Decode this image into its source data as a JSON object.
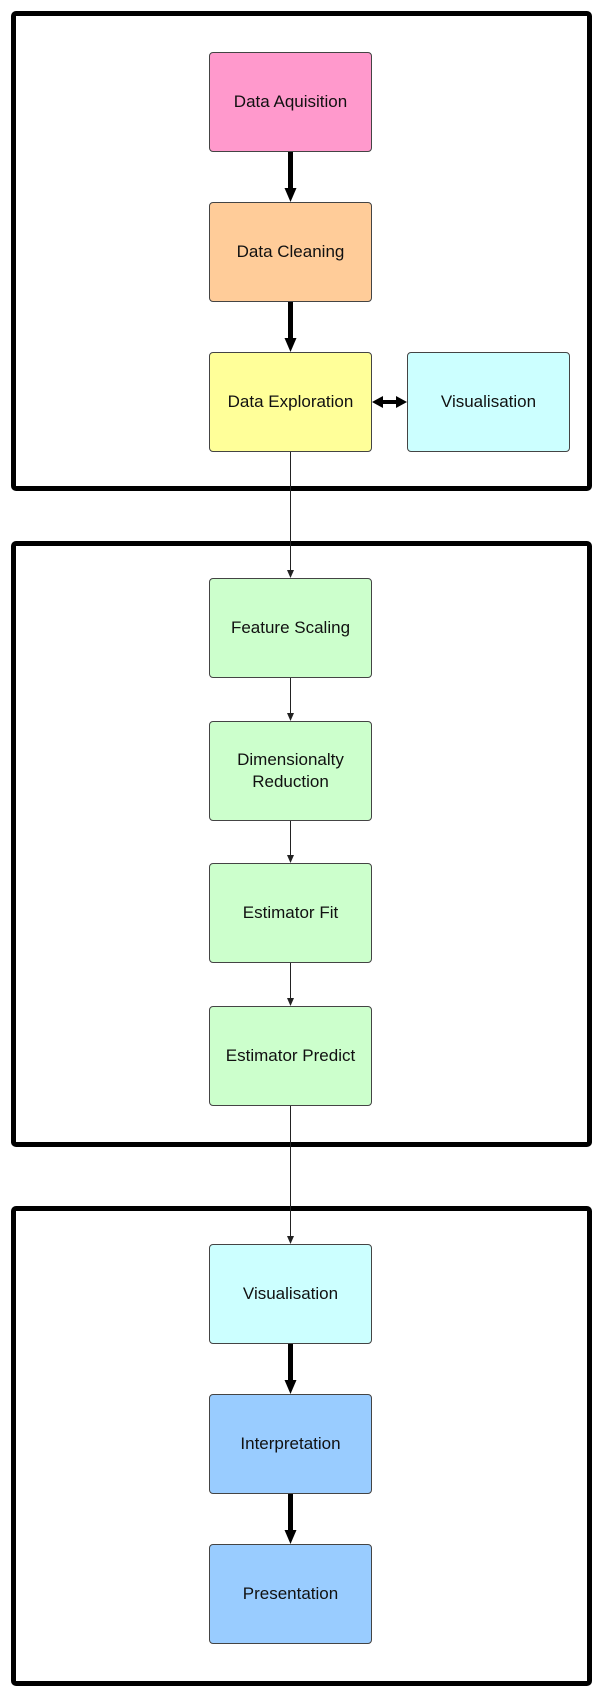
{
  "diagram": {
    "groups": [
      {
        "id": "data-preparation"
      },
      {
        "id": "modelling"
      },
      {
        "id": "communication"
      }
    ],
    "nodes": [
      {
        "id": "data-aquisition",
        "label": "Data Aquisition",
        "color": "#FF99CC"
      },
      {
        "id": "data-cleaning",
        "label": "Data Cleaning",
        "color": "#FFCC99"
      },
      {
        "id": "data-exploration",
        "label": "Data Exploration",
        "color": "#FFFF99"
      },
      {
        "id": "visualisation-explore",
        "label": "Visualisation",
        "color": "#CCFFFF"
      },
      {
        "id": "feature-scaling",
        "label": "Feature Scaling",
        "color": "#CCFFCC"
      },
      {
        "id": "dimensionality-reduction",
        "label": "Dimensionalty Reduction",
        "color": "#CCFFCC"
      },
      {
        "id": "estimator-fit",
        "label": "Estimator Fit",
        "color": "#CCFFCC"
      },
      {
        "id": "estimator-predict",
        "label": "Estimator Predict",
        "color": "#CCFFCC"
      },
      {
        "id": "visualisation-results",
        "label": "Visualisation",
        "color": "#CCFFFF"
      },
      {
        "id": "interpretation",
        "label": "Interpretation",
        "color": "#99CCFF"
      },
      {
        "id": "presentation",
        "label": "Presentation",
        "color": "#99CCFF"
      }
    ],
    "edges": [
      {
        "from": "data-aquisition",
        "to": "data-cleaning",
        "style": "thick"
      },
      {
        "from": "data-cleaning",
        "to": "data-exploration",
        "style": "thick"
      },
      {
        "from": "data-exploration",
        "to": "visualisation-explore",
        "style": "thick-bidirectional"
      },
      {
        "from": "data-exploration",
        "to": "feature-scaling",
        "style": "thin"
      },
      {
        "from": "feature-scaling",
        "to": "dimensionality-reduction",
        "style": "thin"
      },
      {
        "from": "dimensionality-reduction",
        "to": "estimator-fit",
        "style": "thin"
      },
      {
        "from": "estimator-fit",
        "to": "estimator-predict",
        "style": "thin"
      },
      {
        "from": "estimator-predict",
        "to": "visualisation-results",
        "style": "thin"
      },
      {
        "from": "visualisation-results",
        "to": "interpretation",
        "style": "thick"
      },
      {
        "from": "interpretation",
        "to": "presentation",
        "style": "thick"
      }
    ]
  }
}
